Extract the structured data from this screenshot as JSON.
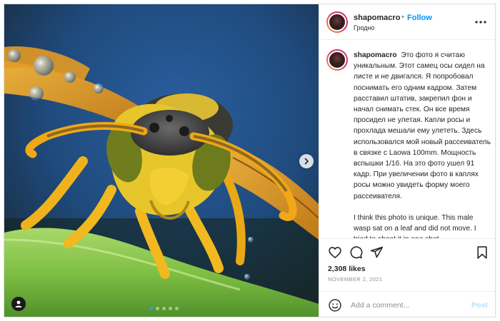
{
  "post": {
    "username": "shapomacro",
    "separator": "•",
    "follow_label": "Follow",
    "location": "Гродно",
    "more_label": "•••",
    "caption_ru": "Это фото я считаю уникальным. Этот самец осы сидел на листе и не двигался. Я попробовал поснимать его одним кадром. Затем расставил штатив, закрепил фон и начал снимать стек. Он все время просидел не улетая. Капли росы и прохлада мешали ему улететь. Здесь использовался мой новый рассеиватель в связке с Laowa 100mm. Мощность вспышки 1/16. На это фото ушел 91 кадр. При увеличении фото в каплях росы можно увидеть форму моего рассеивателя.",
    "caption_en": "I think this photo is unique. This male wasp sat on a leaf and did not move. I tried to shoot it in one shot.",
    "likes": "2,308 likes",
    "date": "NOVEMBER 2, 2021",
    "comment_placeholder": "Add a comment...",
    "post_label": "Post"
  },
  "media": {
    "description_icon": "wasp-macro-photo",
    "carousel_count": 5,
    "active_slide": 1,
    "icons": {
      "next": "chevron-right-icon",
      "user_tag": "user-icon"
    }
  },
  "colors": {
    "accent": "#0095f6",
    "post_disabled": "#b2dffc",
    "text": "#262626",
    "muted": "#8e8e8e"
  }
}
